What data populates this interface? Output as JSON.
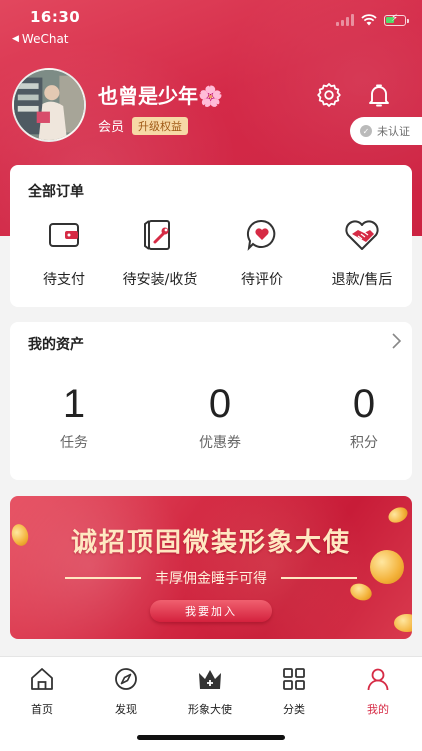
{
  "status_bar": {
    "time": "16:30",
    "back_app": "WeChat"
  },
  "profile": {
    "username": "也曾是少年🌸",
    "member_label": "会员",
    "upgrade_badge": "升级权益",
    "verify_label": "未认证"
  },
  "orders": {
    "title": "全部订单",
    "items": [
      {
        "label": "待支付",
        "icon": "wallet-icon"
      },
      {
        "label": "待安装/收货",
        "icon": "door-wrench-icon"
      },
      {
        "label": "待评价",
        "icon": "heart-bubble-icon"
      },
      {
        "label": "退款/售后",
        "icon": "handshake-heart-icon"
      }
    ]
  },
  "assets": {
    "title": "我的资产",
    "items": [
      {
        "value": "1",
        "label": "任务"
      },
      {
        "value": "0",
        "label": "优惠券"
      },
      {
        "value": "0",
        "label": "积分"
      }
    ]
  },
  "banner": {
    "title": "诚招顶固微装形象大使",
    "subtitle": "丰厚佣金睡手可得",
    "button": "我要加入"
  },
  "tabbar": {
    "items": [
      {
        "label": "首页",
        "icon": "home-icon"
      },
      {
        "label": "发现",
        "icon": "compass-icon"
      },
      {
        "label": "形象大使",
        "icon": "crown-icon"
      },
      {
        "label": "分类",
        "icon": "grid-icon"
      },
      {
        "label": "我的",
        "icon": "user-icon"
      }
    ],
    "active_color": "#d62b45"
  },
  "colors": {
    "brand": "#d42a48",
    "badge_bg": "#f7d9a6"
  }
}
